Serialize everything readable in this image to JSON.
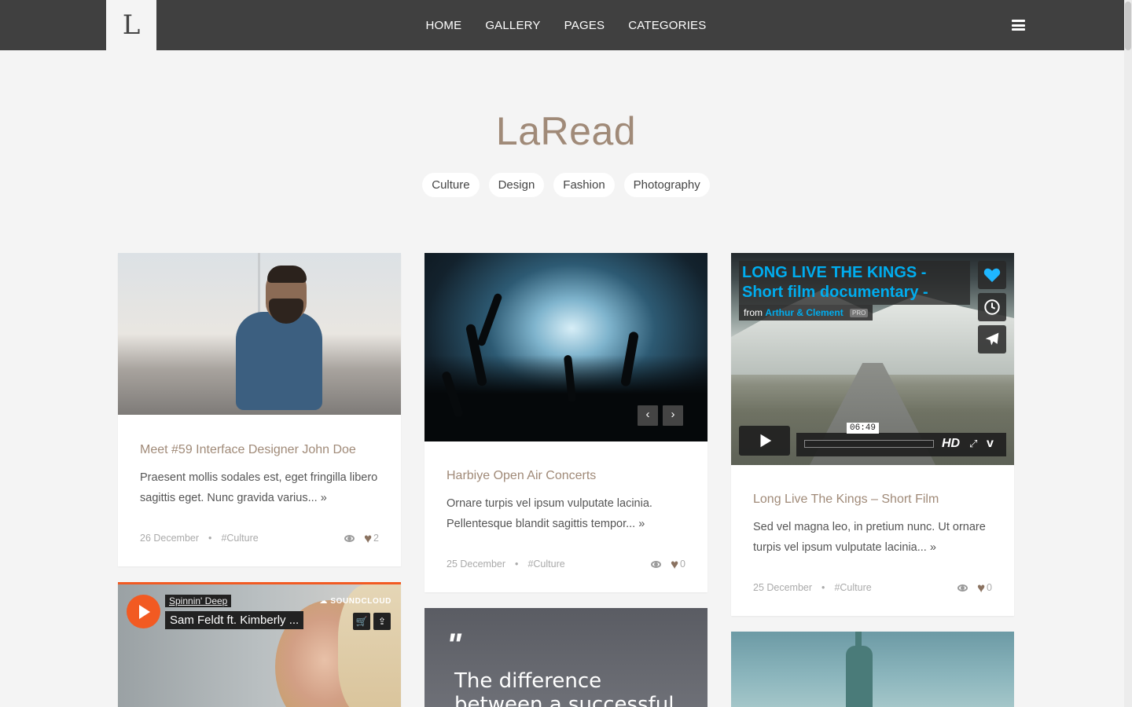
{
  "header": {
    "logo": "L",
    "nav": [
      "HOME",
      "GALLERY",
      "PAGES",
      "CATEGORIES"
    ]
  },
  "hero": {
    "title": "LaRead",
    "tags": [
      "Culture",
      "Design",
      "Fashion",
      "Photography"
    ]
  },
  "posts": [
    {
      "title": "Meet #59 Interface Designer John Doe",
      "excerpt": "Praesent mollis sodales est, eget fringilla libero sagittis eget. Nunc gravida varius... »",
      "date": "26 December",
      "category": "#Culture",
      "likes": "2"
    },
    {
      "title": "Harbiye Open Air Concerts",
      "excerpt": "Ornare turpis vel ipsum vulputate lacinia. Pellentesque blandit sagittis tempor... »",
      "date": "25 December",
      "category": "#Culture",
      "likes": "0"
    },
    {
      "title": "Long Live The Kings – Short Film",
      "excerpt": "Sed vel magna leo, in pretium nunc. Ut ornare turpis vel ipsum vulputate lacinia... »",
      "date": "25 December",
      "category": "#Culture",
      "likes": "0"
    }
  ],
  "video": {
    "title_line1": "LONG LIVE THE KINGS -",
    "title_line2": "Short film documentary -",
    "from_prefix": "from",
    "author": "Arthur & Clement",
    "badge": "PRO",
    "time": "06:49",
    "hd": "HD"
  },
  "soundcloud": {
    "user": "Spinnin' Deep",
    "track": "Sam Feldt ft. Kimberly ...",
    "brand": "SOUNDCLOUD"
  },
  "quote": {
    "mark": "\"",
    "text": "The difference between a successful person and"
  },
  "colors": {
    "accent": "#a08a78",
    "topbar": "#404040",
    "vimeo_blue": "#00adef",
    "soundcloud_orange": "#f25a22"
  }
}
